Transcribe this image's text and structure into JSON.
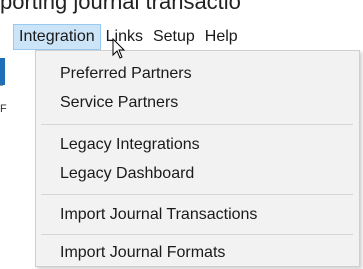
{
  "background": {
    "partial_text": "porting journal transactio"
  },
  "menubar": {
    "items": [
      {
        "label": "Integration",
        "active": true
      },
      {
        "label": "Links"
      },
      {
        "label": "Setup"
      },
      {
        "label": "Help"
      }
    ]
  },
  "left_strip": {
    "letter": "F"
  },
  "dropdown": {
    "items": [
      {
        "label": "Preferred Partners"
      },
      {
        "label": "Service Partners"
      },
      {
        "label": "Legacy Integrations"
      },
      {
        "label": "Legacy Dashboard"
      },
      {
        "label": "Import Journal Transactions"
      },
      {
        "label": "Import Journal Formats"
      }
    ]
  },
  "cursor": {
    "icon": "mouse-pointer-icon"
  },
  "colors": {
    "menu_bg": "#f2f2f2",
    "menubar_highlight": "#cce4f7",
    "accent_blue": "#1e6fb8"
  }
}
